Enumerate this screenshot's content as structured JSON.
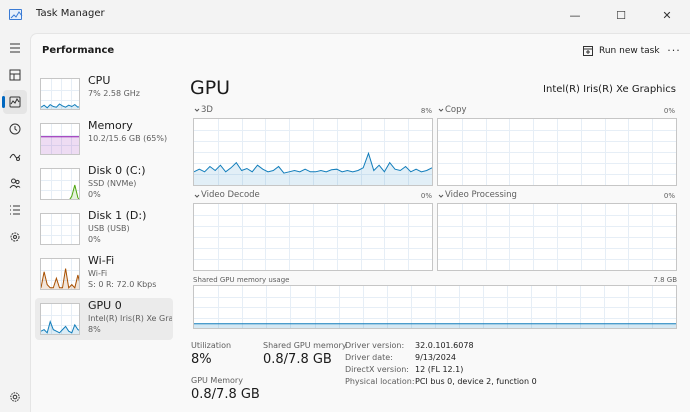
{
  "window": {
    "title": "Task Manager",
    "minimize_glyph": "—",
    "maximize_glyph": "☐",
    "close_glyph": "✕"
  },
  "nav": {
    "icons": [
      "hamburger-icon",
      "processes-icon",
      "performance-icon",
      "app-history-icon",
      "startup-apps-icon",
      "users-icon",
      "details-icon",
      "services-icon",
      "settings-icon"
    ],
    "active": "performance-icon"
  },
  "header": {
    "title": "Performance",
    "run_new_task": "Run new task",
    "more": "···"
  },
  "devices": [
    {
      "name": "CPU",
      "line1": "7% 2.58 GHz",
      "line2": "",
      "color": "#117dbb"
    },
    {
      "name": "Memory",
      "line1": "10.2/15.6 GB (65%)",
      "line2": "",
      "color": "#8b12ae"
    },
    {
      "name": "Disk 0 (C:)",
      "line1": "SSD (NVMe)",
      "line2": "0%",
      "color": "#4da60c"
    },
    {
      "name": "Disk 1 (D:)",
      "line1": "USB (USB)",
      "line2": "0%",
      "color": "#4da60c"
    },
    {
      "name": "Wi-Fi",
      "line1": "Wi-Fi",
      "line2": "S: 0 R: 72.0 Kbps",
      "color": "#a74f01"
    },
    {
      "name": "GPU 0",
      "line1": "Intel(R) Iris(R) Xe Gra...",
      "line2": "8%",
      "color": "#117dbb"
    }
  ],
  "selected_device": "GPU 0",
  "gpu": {
    "title": "GPU",
    "model": "Intel(R) Iris(R) Xe Graphics",
    "engines": [
      {
        "name": "3D",
        "percent": "8%"
      },
      {
        "name": "Copy",
        "percent": "0%"
      },
      {
        "name": "Video Decode",
        "percent": "0%"
      },
      {
        "name": "Video Processing",
        "percent": "0%"
      }
    ],
    "shared_memory_label": "Shared GPU memory usage",
    "shared_memory_max": "7.8 GB",
    "stats": {
      "utilization_label": "Utilization",
      "utilization_value": "8%",
      "shared_label": "Shared GPU memory",
      "shared_value": "0.8/7.8 GB",
      "gpu_memory_label": "GPU Memory",
      "gpu_memory_value": "0.8/7.8 GB"
    },
    "info": [
      {
        "key": "Driver version:",
        "value": "32.0.101.6078"
      },
      {
        "key": "Driver date:",
        "value": "9/13/2024"
      },
      {
        "key": "DirectX version:",
        "value": "12 (FL 12.1)"
      },
      {
        "key": "Physical location:",
        "value": "PCI bus 0, device 2, function 0"
      }
    ],
    "graph_color": "#117dbb"
  }
}
